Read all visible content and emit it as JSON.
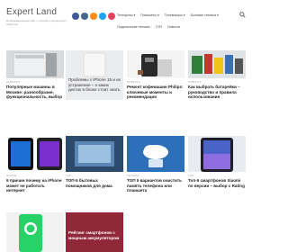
{
  "header": {
    "logo": "Expert Land",
    "tagline": "Информационный сайт о технике и интересных событиях",
    "nav_primary": [
      "Телефоны ▾",
      "Планшеты ▾",
      "Телевизоры ▾",
      "Бытовая техника ▾"
    ],
    "nav_secondary": [
      "Подключение техники",
      "ТОП",
      "Новости"
    ]
  },
  "social_colors": [
    "#3b5998",
    "#45668e",
    "#ff6600",
    "#1da1f2",
    "#e4405f"
  ],
  "cards": [
    {
      "category": "Новости",
      "title": "Популярные машины в Москве: разнообразие, функциональность, выбор"
    },
    {
      "category": "",
      "title": "Проблемы с iPhone 15 и их устранение – о каких дектах в блоке стоит знать"
    },
    {
      "category": "Новости",
      "title": "Ремонт кофемашин Philips: ключевые моменты и рекомендации"
    },
    {
      "category": "Новости",
      "title": "Как выбрать батарейки – руководство и правила использования"
    },
    {
      "category": "iPhone",
      "title": "9 причин почему на iPhone может не работать интернет"
    },
    {
      "category": "ТОП",
      "title": "ТОП-5 бытовых помощников для дома"
    },
    {
      "category": "Техника",
      "title": "ТОП 5 вариантов очистить память телефона или планшета"
    },
    {
      "category": "ТОП",
      "title": "Топ-5 смартфонов Xiaomi по версии – выбор с Rating"
    },
    {
      "category": "",
      "title": ""
    },
    {
      "category": "",
      "title": "Рейтинг смартфонов с мощным аккумулятором"
    }
  ]
}
